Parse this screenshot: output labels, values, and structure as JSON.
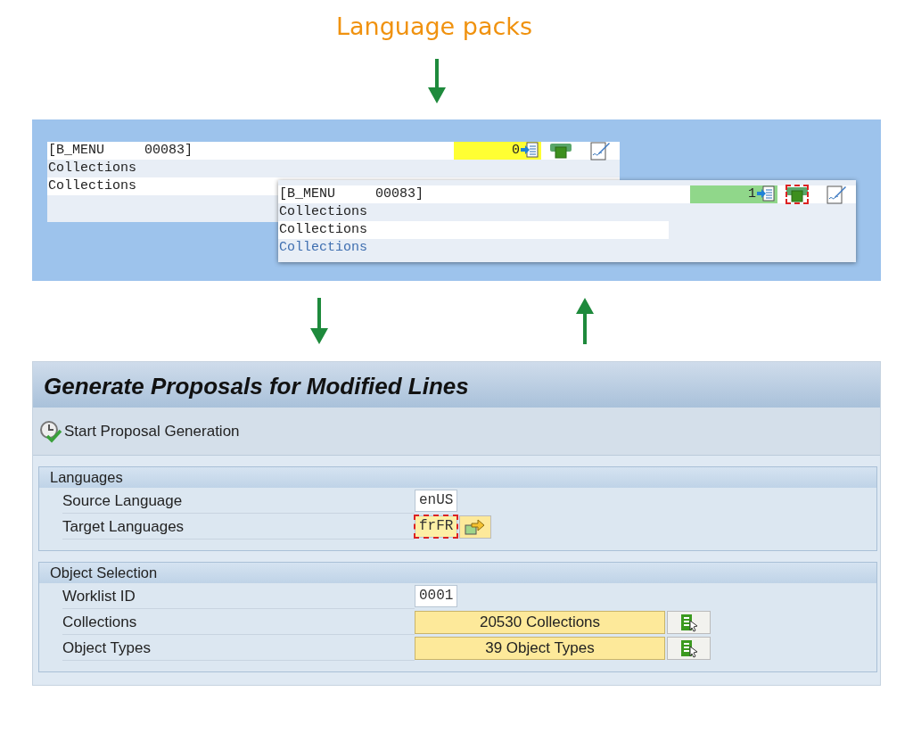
{
  "title": "Language packs",
  "editor_windows": [
    {
      "header": "[B_MENU     00083]",
      "counter": "0",
      "color": "#ffff33",
      "focused_action": false,
      "lines": [
        {
          "text": "Collections",
          "kind": "plain"
        },
        {
          "text": "Collections",
          "kind": "input"
        }
      ]
    },
    {
      "header": "[B_MENU     00083]",
      "counter": "1",
      "color": "#90d78a",
      "focused_action": true,
      "lines": [
        {
          "text": "Collections",
          "kind": "plain"
        },
        {
          "text": "Collections",
          "kind": "input"
        },
        {
          "text": "Collections",
          "kind": "proposal"
        }
      ]
    }
  ],
  "screen": {
    "title": "Generate Proposals for Modified Lines",
    "toolbar_button": "Start Proposal Generation",
    "groups": [
      {
        "title": "Languages",
        "fields": [
          {
            "label": "Source Language",
            "value": "enUS",
            "kind": "input",
            "focused": false
          },
          {
            "label": "Target Languages",
            "value": "frFR",
            "kind": "multi_input",
            "focused": true
          }
        ]
      },
      {
        "title": "Object Selection",
        "fields": [
          {
            "label": "Worklist ID",
            "value": "0001",
            "kind": "input",
            "focused": false
          },
          {
            "label": "Collections",
            "value": "20530  Collections",
            "kind": "selection"
          },
          {
            "label": "Object Types",
            "value": "39  Object Types",
            "kind": "selection"
          }
        ]
      }
    ]
  }
}
